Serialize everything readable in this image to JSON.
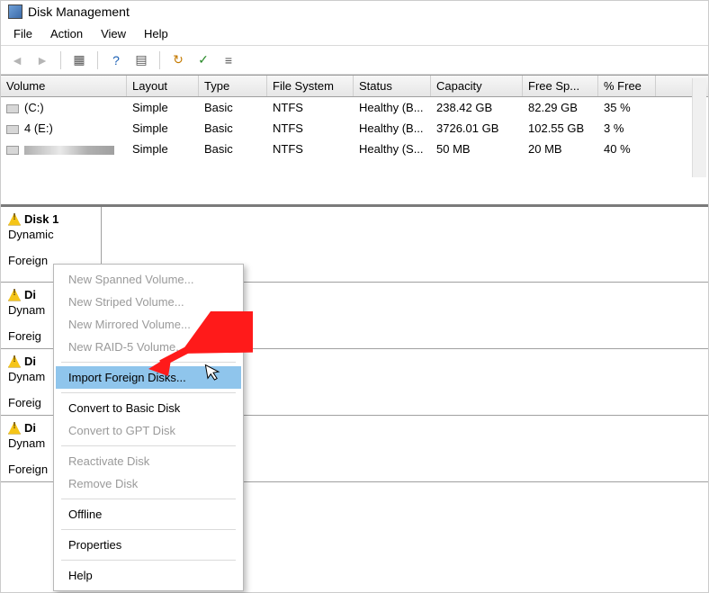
{
  "window": {
    "title": "Disk Management"
  },
  "menu": {
    "file": "File",
    "action": "Action",
    "view": "View",
    "help": "Help"
  },
  "toolbar_icons": {
    "back": "◄",
    "forward": "►",
    "up": "▦",
    "help": "?",
    "props": "▤",
    "refresh": "↻",
    "check": "✓",
    "list": "≡"
  },
  "columns": {
    "volume": "Volume",
    "layout": "Layout",
    "type": "Type",
    "fs": "File System",
    "status": "Status",
    "capacity": "Capacity",
    "free": "Free Sp...",
    "pct": "% Free"
  },
  "volumes": [
    {
      "name": "(C:)",
      "layout": "Simple",
      "type": "Basic",
      "fs": "NTFS",
      "status": "Healthy (B...",
      "capacity": "238.42 GB",
      "free": "82.29 GB",
      "pct": "35 %"
    },
    {
      "name": "4 (E:)",
      "layout": "Simple",
      "type": "Basic",
      "fs": "NTFS",
      "status": "Healthy (B...",
      "capacity": "3726.01 GB",
      "free": "102.55 GB",
      "pct": "3 %"
    },
    {
      "name": "",
      "obscured": true,
      "layout": "Simple",
      "type": "Basic",
      "fs": "NTFS",
      "status": "Healthy (S...",
      "capacity": "50 MB",
      "free": "20 MB",
      "pct": "40 %"
    }
  ],
  "disks": [
    {
      "title": "Disk 1",
      "dyn": "Dynamic",
      "foreign": "Foreign"
    },
    {
      "title": "Di",
      "dyn": "Dynam",
      "foreign": "Foreig"
    },
    {
      "title": "Di",
      "dyn": "Dynam",
      "foreign": "Foreig"
    },
    {
      "title": "Di",
      "dyn": "Dynam",
      "foreign": "Foreign"
    }
  ],
  "context_menu": {
    "new_spanned": "New Spanned Volume...",
    "new_striped": "New Striped Volume...",
    "new_mirrored": "New Mirrored Volume...",
    "new_raid5": "New RAID-5 Volume...",
    "import_foreign": "Import Foreign Disks...",
    "convert_basic": "Convert to Basic Disk",
    "convert_gpt": "Convert to GPT Disk",
    "reactivate": "Reactivate Disk",
    "remove": "Remove Disk",
    "offline": "Offline",
    "properties": "Properties",
    "help": "Help"
  }
}
